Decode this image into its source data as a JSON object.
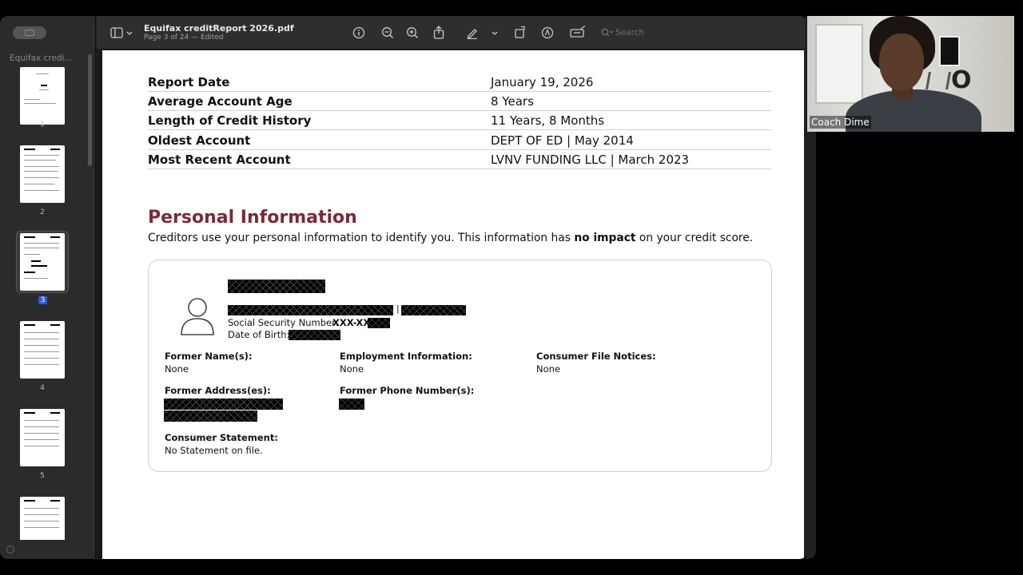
{
  "window": {
    "doc_title": "Equifax creditReport 2026.pdf",
    "doc_subtitle": "Page 3 of 24 — Edited"
  },
  "toolbar": {
    "search_placeholder": "Search",
    "icons": [
      "sidebar-icon",
      "chevron-down-icon",
      "info-icon",
      "zoom-out-icon",
      "zoom-in-icon",
      "share-icon",
      "markup-pen-icon",
      "chevron-down-icon",
      "rotate-icon",
      "annotate-icon",
      "markup-toolbar-icon",
      "search-icon"
    ]
  },
  "sidebar": {
    "title": "Equifax credi...",
    "thumbnails": [
      {
        "label": "1"
      },
      {
        "label": "2"
      },
      {
        "label": "3",
        "selected": true
      },
      {
        "label": "4"
      },
      {
        "label": "5"
      },
      {
        "label": ""
      }
    ]
  },
  "report": {
    "rows": [
      {
        "label": "Report Date",
        "value": "January 19, 2026"
      },
      {
        "label": "Average Account Age",
        "value": "8 Years"
      },
      {
        "label": "Length of Credit History",
        "value": "11 Years, 8 Months"
      },
      {
        "label": "Oldest Account",
        "value": "DEPT OF ED | May 2014"
      },
      {
        "label": "Most Recent Account",
        "value": "LVNV FUNDING LLC | March 2023"
      }
    ]
  },
  "personal": {
    "title": "Personal Information",
    "desc_before": "Creditors use your personal information to identify you. This information has ",
    "desc_bold": "no impact",
    "desc_after": " on your credit score.",
    "ssn_label": "Social Security Number:",
    "ssn_value": "XXX-XX-",
    "dob_label": "Date of Birth:",
    "pipe": "|",
    "former_names_label": "Former Name(s):",
    "former_names_value": "None",
    "employment_label": "Employment Information:",
    "employment_value": "None",
    "notices_label": "Consumer File Notices:",
    "notices_value": "None",
    "former_address_label": "Former Address(es):",
    "former_phone_label": "Former Phone Number(s):",
    "statement_label": "Consumer Statement:",
    "statement_value": "No Statement on file."
  },
  "webcam": {
    "participant_name": "Coach Dime"
  }
}
